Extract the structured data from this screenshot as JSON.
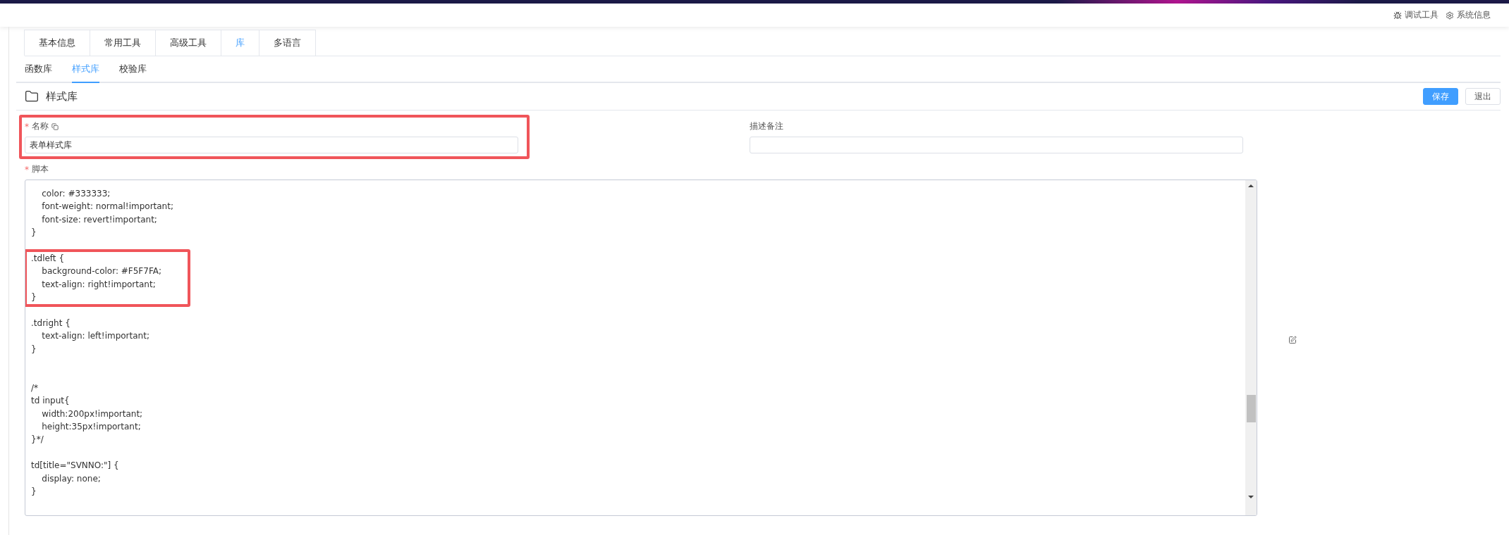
{
  "header_tools": [
    {
      "kind": "debug",
      "label": "调试工具"
    },
    {
      "kind": "settings",
      "label": "系统信息"
    }
  ],
  "tabs": [
    {
      "label": "基本信息",
      "selected": false
    },
    {
      "label": "常用工具",
      "selected": false
    },
    {
      "label": "高级工具",
      "selected": false
    },
    {
      "label": "库",
      "selected": true
    },
    {
      "label": "多语言",
      "selected": false
    }
  ],
  "sub_tabs": [
    {
      "label": "函数库",
      "selected": false
    },
    {
      "label": "样式库",
      "selected": true
    },
    {
      "label": "校验库",
      "selected": false
    }
  ],
  "section": {
    "title": "样式库",
    "buttons": [
      {
        "label": "保存",
        "kind": "primary"
      },
      {
        "label": "退出",
        "kind": "default"
      }
    ]
  },
  "name_field": {
    "label": "名称",
    "required_mark": "*",
    "value": "表单样式库",
    "highlighted": true
  },
  "description_field": {
    "label": "描述备注"
  },
  "script": {
    "label": "脚本",
    "required_mark": "*",
    "code": [
      {
        "kind": "block",
        "highlighted": false,
        "lines": [
          "\tcolor: #333333;",
          "\tfont-weight: normal!important;",
          "\tfont-size: revert!important;",
          "}"
        ]
      },
      {
        "kind": "blank"
      },
      {
        "kind": "block",
        "highlighted": true,
        "lines": [
          ".tdleft {",
          "\tbackground-color: #F5F7FA;",
          "\ttext-align: right!important;",
          "}"
        ]
      },
      {
        "kind": "blank"
      },
      {
        "kind": "block",
        "highlighted": false,
        "lines": [
          ".tdright {",
          "\ttext-align: left!important;",
          "}"
        ]
      },
      {
        "kind": "blank"
      },
      {
        "kind": "blank"
      },
      {
        "kind": "block",
        "highlighted": false,
        "lines": [
          "/*",
          "td input{",
          "\twidth:200px!important;",
          "\theight:35px!important;",
          "}*/"
        ]
      },
      {
        "kind": "blank"
      },
      {
        "kind": "block",
        "highlighted": false,
        "lines": [
          "td[title=\"SVNNO:\"] {",
          "\tdisplay: none;",
          "}"
        ]
      }
    ]
  }
}
